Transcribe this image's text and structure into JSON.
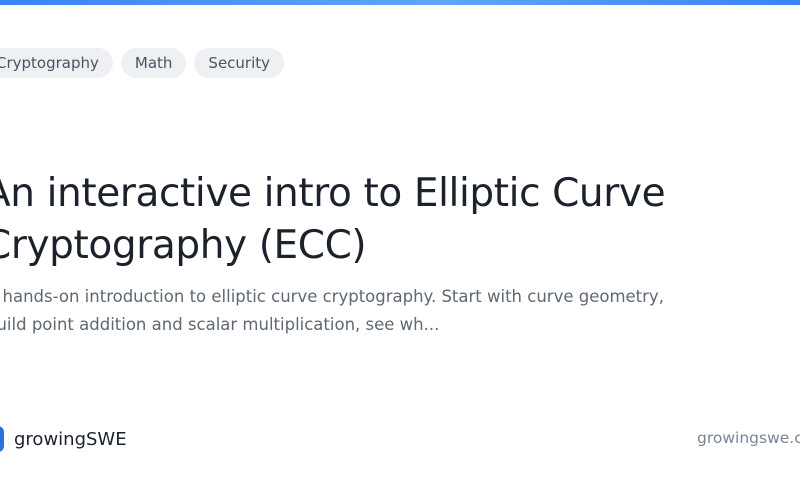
{
  "tags": [
    "Cryptography",
    "Math",
    "Security"
  ],
  "title": "An interactive intro to Elliptic Curve Cryptography (ECC)",
  "description": "A hands-on introduction to elliptic curve cryptography. Start with curve geometry, build point addition and scalar multiplication, see wh...",
  "brand": {
    "name": "growingSWE",
    "url": "growingswe.com"
  },
  "colors": {
    "accent": "#3b82f6",
    "logo": "#2f6fe4",
    "tag_background": "#eef0f3"
  }
}
